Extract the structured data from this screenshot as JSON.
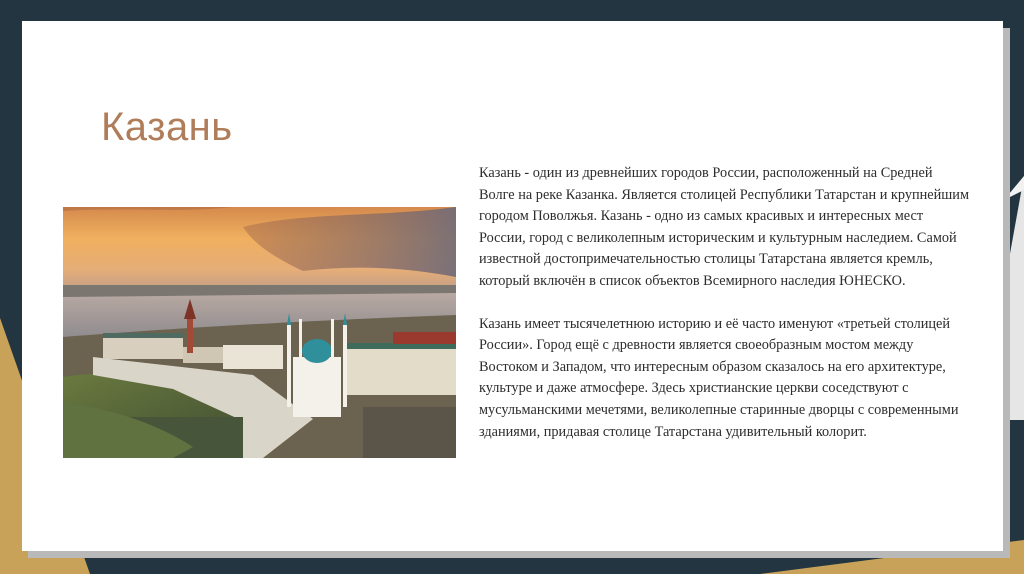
{
  "slide": {
    "title": "Казань",
    "paragraphs": [
      "Казань - один из древнейших городов России, расположенный на Средней Волге на реке Казанка. Является столицей Республики Татарстан и крупнейшим городом Поволжья. Казань - одно из самых красивых и интересных мест России, город с великолепным историческим и культурным наследием. Самой известной достопримечательностью столицы Татарстана является кремль, который включён в список объектов Всемирного наследия ЮНЕСКО.",
      "Казань имеет тысячелетнюю историю и её часто именуют «третьей столицей России». Город ещё с древности является своеобразным мостом между Востоком и Западом, что интересным образом сказалось на его архитектуре, культуре и даже атмосфере. Здесь христианские церкви соседствуют с мусульманскими мечетями, великолепные старинные дворцы с современными зданиями, придавая столице Татарстана удивительный колорит."
    ]
  },
  "colors": {
    "background_dark": "#233540",
    "accent_gold": "#c9a25a",
    "title_color": "#b07d5b"
  }
}
